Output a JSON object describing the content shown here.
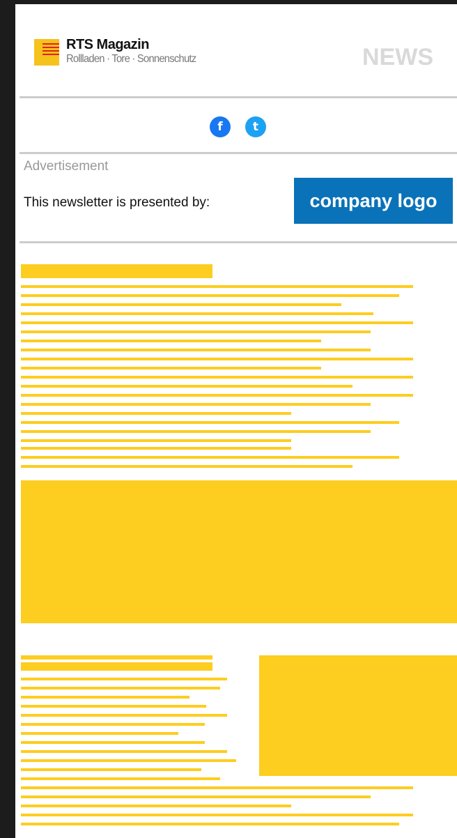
{
  "header": {
    "brand_title": "RTS Magazin",
    "brand_subtitle": "Rollladen · Tore · Sonnenschutz",
    "news_label": "NEWS",
    "logo_icon": "rts-flag-logo-icon"
  },
  "social": {
    "facebook_icon": "facebook-icon",
    "facebook_glyph": "f",
    "twitter_icon": "twitter-icon",
    "twitter_glyph": "t"
  },
  "advertisement": {
    "label": "Advertisement",
    "presented_by": "This newsletter is presented by:",
    "company_logo": "company logo"
  },
  "colors": {
    "placeholder": "#fdcd20",
    "company_logo_bg": "#0a72b8",
    "facebook": "#1877f2",
    "twitter": "#1da1f2",
    "divider": "#cccccc",
    "logo_red": "#e2231a"
  }
}
